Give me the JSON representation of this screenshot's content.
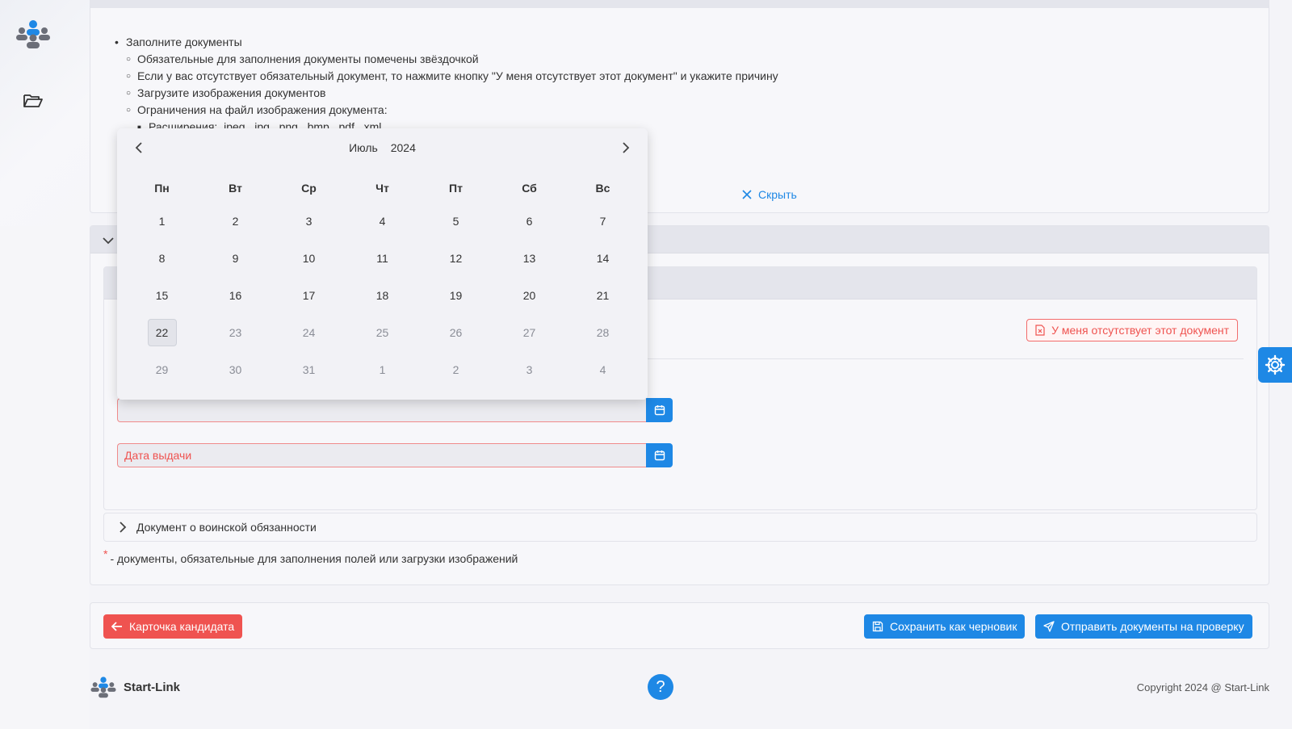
{
  "colors": {
    "accent": "#1e88e5",
    "danger": "#ef5350",
    "panel": "#f7f7fa"
  },
  "rail": {
    "logo_icon": "people-group-icon",
    "folder_icon": "folder-open-icon"
  },
  "instructions": {
    "item1": "Заполните документы",
    "sub": [
      "Обязательные для заполнения документы помечены звёздочкой",
      "Если у вас отсутствует обязательный документ, то нажмите кнопку \"У меня отсутствует этот документ\" и укажите причину",
      "Загрузите изображения документов",
      "Ограничения на файл изображения документа:"
    ],
    "sub2": "Расширения: .jpeg, .jpg, .png, .bmp, .pdf, .xml",
    "hide_label": "Скрыть"
  },
  "calendar": {
    "month": "Июль",
    "year": "2024",
    "weekdays": [
      "Пн",
      "Вт",
      "Ср",
      "Чт",
      "Пт",
      "Сб",
      "Вс"
    ],
    "weeks": [
      [
        "1",
        "2",
        "3",
        "4",
        "5",
        "6",
        "7"
      ],
      [
        "8",
        "9",
        "10",
        "11",
        "12",
        "13",
        "14"
      ],
      [
        "15",
        "16",
        "17",
        "18",
        "19",
        "20",
        "21"
      ],
      [
        "22",
        "23",
        "24",
        "25",
        "26",
        "27",
        "28"
      ],
      [
        "29",
        "30",
        "31",
        "1",
        "2",
        "3",
        "4"
      ]
    ],
    "today": "22"
  },
  "document": {
    "absent_button": "У меня отсутствует этот документ",
    "first_date_value": "",
    "issue_date_placeholder": "Дата выдачи"
  },
  "military": {
    "label": "Документ о воинской обязанности"
  },
  "legend": {
    "star": "*",
    "text": "- документы, обязательные для заполнения полей или загрузки изображений"
  },
  "actions": {
    "back": "Карточка кандидата",
    "draft": "Сохранить как черновик",
    "send": "Отправить документы на проверку"
  },
  "footer": {
    "brand": "Start-Link",
    "help": "?",
    "copyright": "Copyright 2024 @ Start-Link"
  }
}
